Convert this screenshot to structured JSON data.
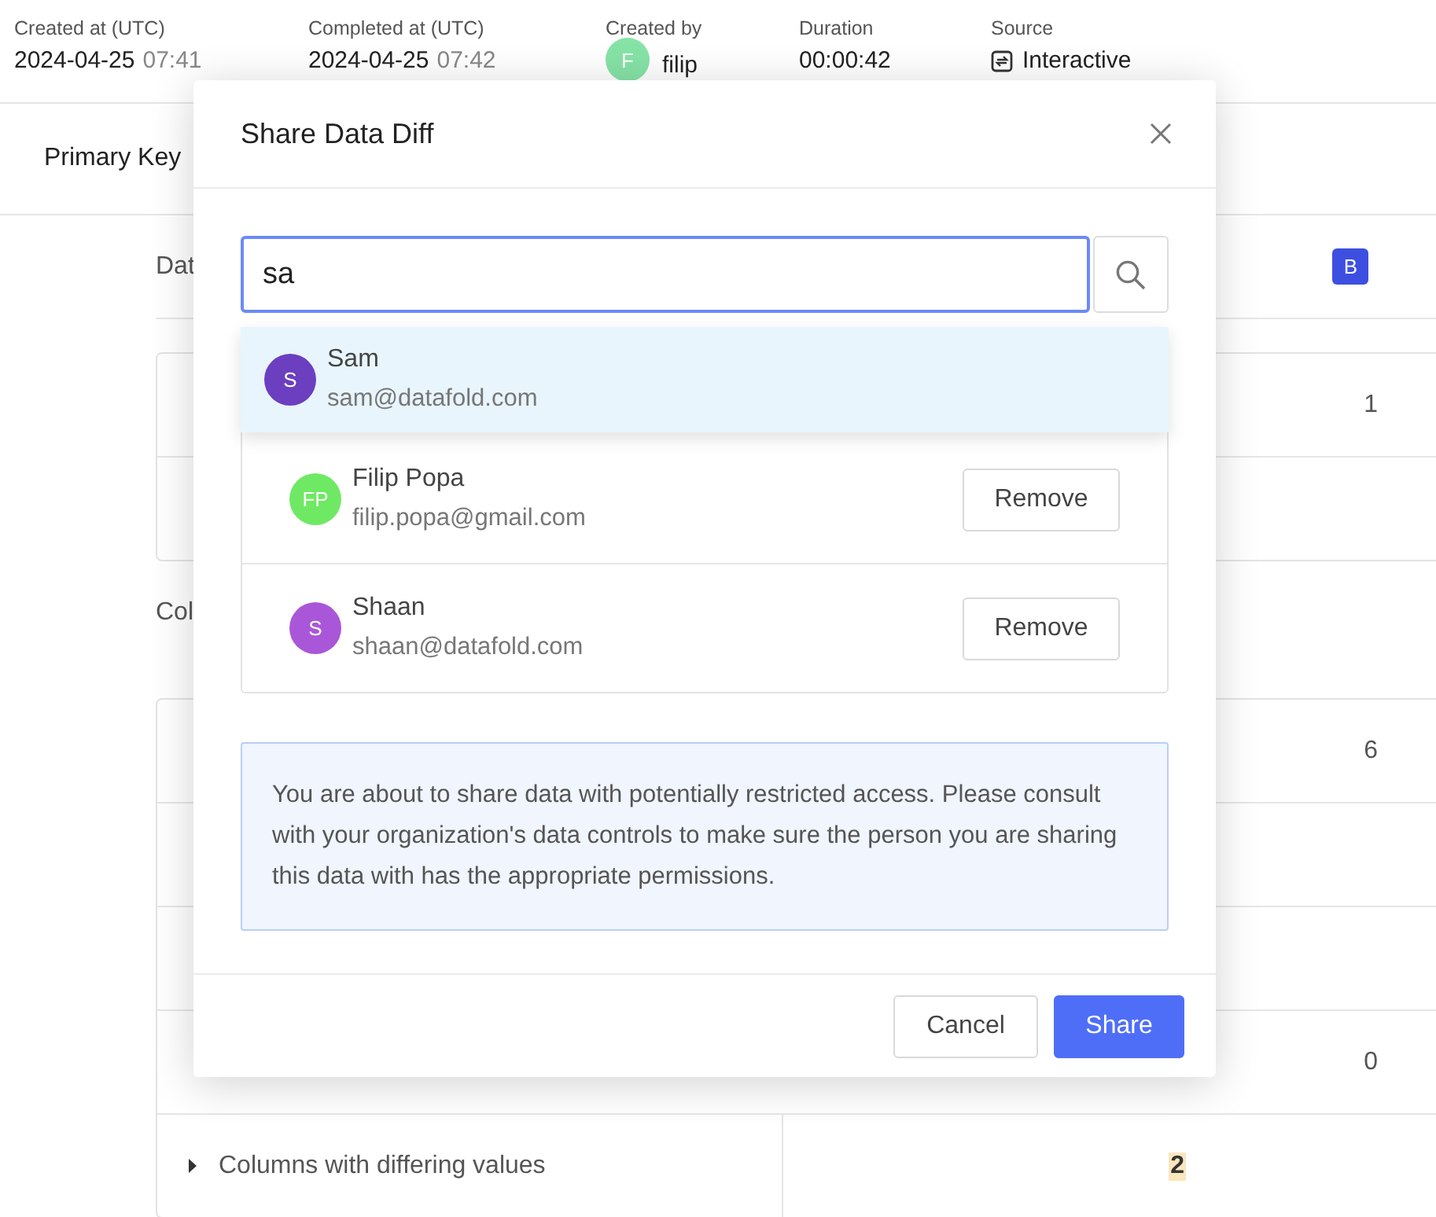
{
  "header": {
    "fields": [
      {
        "kind": "datetime",
        "label": "Created at (UTC)",
        "date": "2024-04-25",
        "time": "07:41"
      },
      {
        "kind": "datetime",
        "label": "Completed at (UTC)",
        "date": "2024-04-25",
        "time": "07:42"
      },
      {
        "kind": "user",
        "label": "Created by",
        "initials": "F",
        "color": "#86e3a6",
        "value": "filip"
      },
      {
        "kind": "text",
        "label": "Duration",
        "value": "00:00:42"
      },
      {
        "kind": "source",
        "label": "Source",
        "value": "Interactive"
      }
    ]
  },
  "tab": {
    "label": "Primary Key"
  },
  "sections": [
    {
      "heading": "Dat",
      "badge": "B",
      "rows": [
        {
          "value": "1"
        },
        {}
      ]
    },
    {
      "heading": "Col",
      "rows": [
        {
          "value": "6"
        },
        {},
        {},
        {
          "value": "0"
        }
      ],
      "summary": {
        "label": "Columns with differing values",
        "value": "2",
        "expanded": false
      }
    }
  ],
  "modal": {
    "title": "Share Data Diff",
    "search": {
      "value": "sa"
    },
    "suggestions": [
      {
        "initials": "S",
        "name": "Sam",
        "email": "sam@datafold.com",
        "color": "#6b3fc0",
        "selected": true
      }
    ],
    "shared_with": [
      {
        "initials": "FP",
        "name": "Filip Popa",
        "email": "filip.popa@gmail.com",
        "color": "#6fe964",
        "action": "Remove"
      },
      {
        "initials": "S",
        "name": "Shaan",
        "email": "shaan@datafold.com",
        "color": "#a957d8",
        "action": "Remove"
      }
    ],
    "notice": "You are about to share data with potentially restricted access. Please consult with your organization's data controls to make sure the person you are sharing this data with has the appropriate permissions.",
    "buttons": [
      {
        "label": "Cancel",
        "kind": "secondary"
      },
      {
        "label": "Share",
        "kind": "primary"
      }
    ]
  }
}
